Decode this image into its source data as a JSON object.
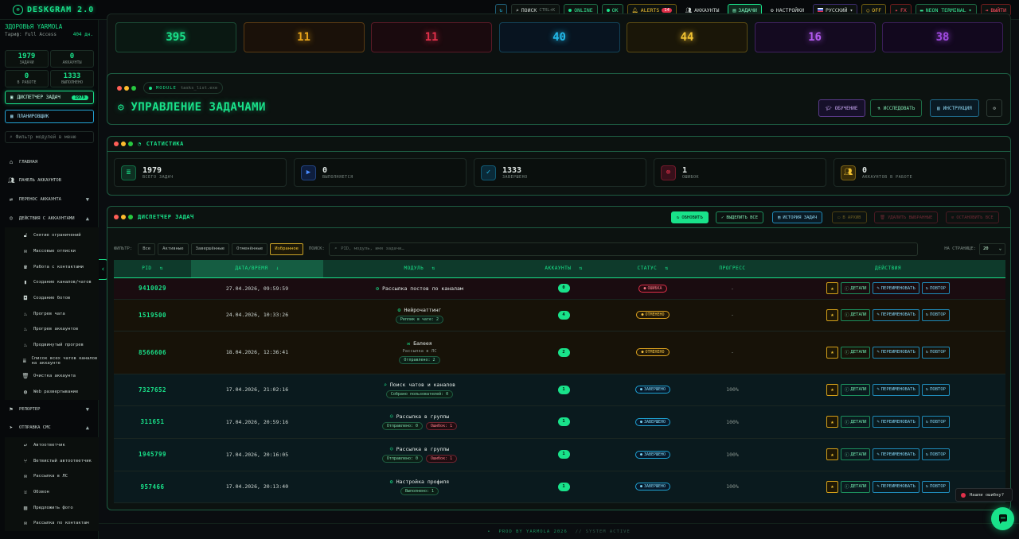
{
  "brand": {
    "name": "DESKGRAM 2.0",
    "icon": "logo-icon"
  },
  "topbar": {
    "refresh_icon": "refresh-icon",
    "search_label": "ПОИСК",
    "search_kbd": "CTRL+K",
    "online": "ONLINE",
    "ok": "OK",
    "alerts": "ALERTS",
    "alerts_count": "14",
    "accounts": "АККАУНТЫ",
    "tasks": "ЗАДАЧИ",
    "settings": "НАСТРОЙКИ",
    "language": "РУССКИЙ",
    "off": "OFF",
    "fx": "FX",
    "terminal": "NEON TERMINAL",
    "logout": "ВЫЙТИ"
  },
  "sidebar": {
    "user_name": "ЗДОРОВЬЯ YARMOLA",
    "plan": "Тариф: Full Access",
    "days": "404 дн.",
    "stats": [
      {
        "value": "1979",
        "label": "ЗАДАЧИ"
      },
      {
        "value": "0",
        "label": "АККАУНТЫ"
      },
      {
        "value": "0",
        "label": "В РАБОТЕ"
      },
      {
        "value": "1333",
        "label": "ВЫПОЛНЕНО"
      }
    ],
    "dispatcher_label": "ДИСПЕТЧЕР ЗАДАЧ",
    "dispatcher_count": "1979",
    "planner_label": "ПЛАНИРОВЩИК",
    "filter_placeholder": "Фильтр модулей в меню",
    "nav": [
      {
        "label": "ГЛАВНАЯ",
        "icon": "home-icon",
        "type": "top"
      },
      {
        "label": "ПАНЕЛЬ АККАУНТОВ",
        "icon": "users-icon",
        "type": "top"
      },
      {
        "label": "ПЕРЕНОС АККАУНТА",
        "icon": "user-transfer-icon",
        "type": "top",
        "chevron": "▼"
      },
      {
        "label": "ДЕЙСТВИЯ С АККАУНТАМИ",
        "icon": "user-actions-icon",
        "type": "top",
        "chevron": "▲"
      },
      {
        "label": "Снятие ограничений",
        "icon": "unlock-icon",
        "type": "sub"
      },
      {
        "label": "Массовые отписки",
        "icon": "unsubscribe-icon",
        "type": "sub"
      },
      {
        "label": "Работа с контактами",
        "icon": "contacts-icon",
        "type": "sub"
      },
      {
        "label": "Создание каналов/чатов",
        "icon": "channel-icon",
        "type": "sub"
      },
      {
        "label": "Создание ботов",
        "icon": "bot-icon",
        "type": "sub"
      },
      {
        "label": "Прогрев чата",
        "icon": "flame-icon",
        "type": "sub"
      },
      {
        "label": "Прогрев аккаунтов",
        "icon": "flame-icon",
        "type": "sub"
      },
      {
        "label": "Продвинутый прогрев",
        "icon": "flame-icon",
        "type": "sub"
      },
      {
        "label": "Список всех чатов каналов на аккаунте",
        "icon": "list-icon",
        "type": "sub"
      },
      {
        "label": "Очистка аккаунта",
        "icon": "trash-icon",
        "type": "sub"
      },
      {
        "label": "Web развертывание",
        "icon": "globe-icon",
        "type": "sub"
      },
      {
        "label": "РЕПОРТЕР",
        "icon": "flag-icon",
        "type": "top",
        "chevron": "▼"
      },
      {
        "label": "ОТПРАВКА СМС",
        "icon": "send-icon",
        "type": "top",
        "chevron": "▲"
      },
      {
        "label": "Автоответчик",
        "icon": "autoreply-icon",
        "type": "sub"
      },
      {
        "label": "Ветвистый автоответчик",
        "icon": "branch-icon",
        "type": "sub"
      },
      {
        "label": "Рассылка в ЛС",
        "icon": "mail-icon",
        "type": "sub"
      },
      {
        "label": "Обзвон",
        "icon": "phone-icon",
        "type": "sub"
      },
      {
        "label": "Предложить фото",
        "icon": "image-icon",
        "type": "sub"
      },
      {
        "label": "Рассылка по контактам",
        "icon": "contacts-mail-icon",
        "type": "sub"
      }
    ]
  },
  "top_cards": [
    {
      "value": "395",
      "color": "#19e28a",
      "border": "#1b4c35",
      "bg": "#0a1812"
    },
    {
      "value": "11",
      "color": "#e6a319",
      "border": "#5a3a12",
      "bg": "#1a1109"
    },
    {
      "value": "11",
      "color": "#e0304a",
      "border": "#5a1a26",
      "bg": "#1a0a0e"
    },
    {
      "value": "40",
      "color": "#22b8e8",
      "border": "#124258",
      "bg": "#081420"
    },
    {
      "value": "44",
      "color": "#f1c232",
      "border": "#5a4a12",
      "bg": "#1a1608"
    },
    {
      "value": "16",
      "color": "#b45af0",
      "border": "#3f2160",
      "bg": "#140a20"
    },
    {
      "value": "38",
      "color": "#a04ae0",
      "border": "#3a1e58",
      "bg": "#12081e"
    }
  ],
  "module_panel": {
    "chip_module": "MODULE",
    "chip_file": "tasks_list.exe",
    "title": "УПРАВЛЕНИЕ ЗАДАЧАМИ",
    "btn_learn": "ОБУЧЕНИЕ",
    "btn_research": "ИССЛЕДОВАТЬ",
    "btn_instr": "ИНСТРУКЦИЯ"
  },
  "stats_panel": {
    "title": "СТАТИСТИКА",
    "cards": [
      {
        "value": "1979",
        "label": "ВСЕГО ЗАДАЧ",
        "icon": "list-icon",
        "color": "#19e28a",
        "bg": "#0e3022"
      },
      {
        "value": "0",
        "label": "ВЫПОЛНЯЕТСЯ",
        "icon": "play-icon",
        "color": "#4a8cff",
        "bg": "#0e1e3e"
      },
      {
        "value": "1333",
        "label": "ЗАВЕРШЕНО",
        "icon": "check-icon",
        "color": "#22b8e8",
        "bg": "#0a2a38"
      },
      {
        "value": "1",
        "label": "ОШИБОК",
        "icon": "error-icon",
        "color": "#e0304a",
        "bg": "#38101a"
      },
      {
        "value": "0",
        "label": "АККАУНТОВ В РАБОТЕ",
        "icon": "accounts-icon",
        "color": "#f1c232",
        "bg": "#382c08"
      }
    ]
  },
  "dispatcher": {
    "title": "ДИСПЕТЧЕР ЗАДАЧ",
    "btn_refresh": "ОБНОВИТЬ",
    "btn_select_all": "ВЫДЕЛИТЬ ВСЕ",
    "btn_history": "ИСТОРИЯ ЗАДАЧ",
    "btn_archive": "В АРХИВ",
    "btn_delete": "УДАЛИТЬ ВЫБРАННЫЕ",
    "btn_stop": "ОСТАНОВИТЬ ВСЕ",
    "filter_label": "ФИЛЬТР:",
    "filters": [
      "Все",
      "Активные",
      "Завершённые",
      "Отменённые",
      "Избранное"
    ],
    "active_filter": 4,
    "search_label": "ПОИСК:",
    "search_placeholder": "PID, модуль, имя задачи…",
    "per_page_label": "НА СТРАНИЦЕ:",
    "per_page": "20",
    "columns": [
      "PID",
      "ДАТА/ВРЕМЯ",
      "МОДУЛЬ",
      "АККАУНТЫ",
      "СТАТУС",
      "ПРОГРЕСС",
      "ДЕЙСТВИЯ"
    ],
    "action_labels": {
      "details": "ДЕТАЛИ",
      "rename": "ПЕРЕИМЕНОВАТЬ",
      "repeat": "ПОВТОР"
    },
    "rows": [
      {
        "pid": "9410029",
        "date": "27.04.2026, 09:59:59",
        "module": "Рассылка постов по каналам",
        "icon": "module-icon",
        "sub": "",
        "tags": [],
        "accounts": "0",
        "status": "ОШИБКА",
        "status_type": "err",
        "progress": "-",
        "row_bg": "#1a0c10",
        "h": 27
      },
      {
        "pid": "1519500",
        "date": "24.04.2026, 10:33:26",
        "module": "Нейрочаттинг",
        "icon": "ai-icon",
        "sub": "",
        "tags": [
          {
            "text": "Реплик в чате: 2",
            "red": false
          }
        ],
        "accounts": "4",
        "status": "ОТМЕНЕНО",
        "status_type": "can",
        "progress": "-",
        "row_bg": "#171208",
        "h": 40
      },
      {
        "pid": "8566606",
        "date": "18.04.2026, 12:36:41",
        "module": "Балеея",
        "icon": "mail-icon",
        "sub": "Рассылка в ЛС",
        "tags": [
          {
            "text": "Отправлено: 2",
            "red": false
          }
        ],
        "accounts": "2",
        "status": "ОТМЕНЕНО",
        "status_type": "can",
        "progress": "-",
        "row_bg": "#171208",
        "h": 54
      },
      {
        "pid": "7327652",
        "date": "17.04.2026, 21:02:16",
        "module": "Поиск чатов и каналов",
        "icon": "search-icon",
        "sub": "",
        "tags": [
          {
            "text": "Собрано пользователей: 0",
            "red": false
          }
        ],
        "accounts": "1",
        "status": "ЗАВЕРШЕНО",
        "status_type": "done",
        "progress": "100%",
        "row_bg": "#0a1a1e",
        "h": 40
      },
      {
        "pid": "311651",
        "date": "17.04.2026, 20:59:16",
        "module": "Рассылка в группы",
        "icon": "chat-icon",
        "sub": "",
        "tags": [
          {
            "text": "Отправлено: 0",
            "red": false
          },
          {
            "text": "Ошибок: 1",
            "red": true
          }
        ],
        "accounts": "1",
        "status": "ЗАВЕРШЕНО",
        "status_type": "done",
        "progress": "100%",
        "row_bg": "#0a1a1e",
        "h": 41
      },
      {
        "pid": "1945799",
        "date": "17.04.2026, 20:16:05",
        "module": "Рассылка в группы",
        "icon": "chat-icon",
        "sub": "",
        "tags": [
          {
            "text": "Отправлено: 0",
            "red": false
          },
          {
            "text": "Ошибок: 1",
            "red": true
          }
        ],
        "accounts": "1",
        "status": "ЗАВЕРШЕНО",
        "status_type": "done",
        "progress": "100%",
        "row_bg": "#0a1a1e",
        "h": 41
      },
      {
        "pid": "957466",
        "date": "17.04.2026, 20:13:40",
        "module": "Настройка профиля",
        "icon": "gear-icon",
        "sub": "",
        "tags": [
          {
            "text": "Выполнено: 1",
            "red": false
          }
        ],
        "accounts": "1",
        "status": "ЗАВЕРШЕНО",
        "status_type": "done",
        "progress": "100%",
        "row_bg": "#0a1a1e",
        "h": 40
      }
    ]
  },
  "footer": {
    "prod": "PROD BY YARMOLA 2026",
    "sys": "// SYSTEM ACTIVE"
  },
  "bug_report": "Нашли ошибку?"
}
